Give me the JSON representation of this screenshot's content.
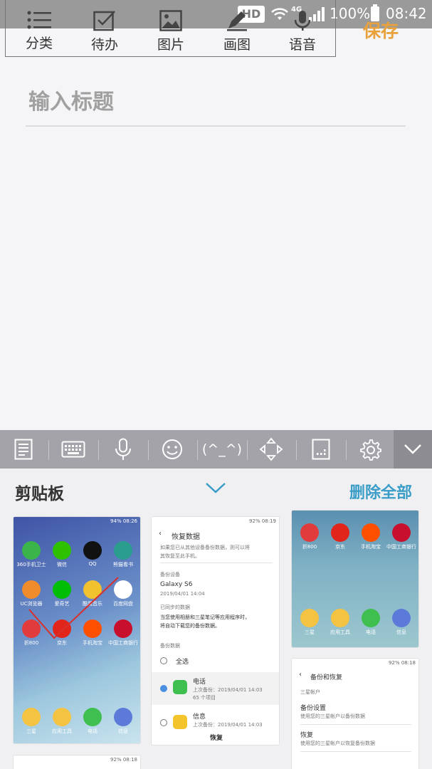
{
  "status_bar": {
    "hd": "HD",
    "network": "4G",
    "battery": "100%",
    "time": "08:42"
  },
  "toolbar": {
    "items": [
      {
        "label": "分类",
        "icon": "list-icon"
      },
      {
        "label": "待办",
        "icon": "checkbox-icon"
      },
      {
        "label": "图片",
        "icon": "image-icon"
      },
      {
        "label": "画图",
        "icon": "pen-icon"
      },
      {
        "label": "语音",
        "icon": "microphone-icon"
      }
    ],
    "save_label": "保存"
  },
  "editor": {
    "title_placeholder": "输入标题"
  },
  "keyboard_bar": {
    "buttons": [
      "notepad-icon",
      "keyboard-icon",
      "microphone-icon",
      "emoji-icon",
      "kaomoji",
      "cursor-move-icon",
      "handwriting-icon",
      "settings-icon",
      "collapse-icon"
    ],
    "kaomoji_label": "(^_^)"
  },
  "clipboard": {
    "title": "剪贴板",
    "delete_all_label": "删除全部",
    "thumb1": {
      "status": "94% 08:26",
      "apps": [
        {
          "name": "360手机卫士",
          "color": "#3bb54a"
        },
        {
          "name": "微信",
          "color": "#2dc100"
        },
        {
          "name": "QQ",
          "color": "#111111"
        },
        {
          "name": "熊猫看书",
          "color": "#2a9d8f"
        },
        {
          "name": "UC浏览器",
          "color": "#f08c2c"
        },
        {
          "name": "爱奇艺",
          "color": "#00be06"
        },
        {
          "name": "酷我音乐",
          "color": "#f2c12e"
        },
        {
          "name": "百度网盘",
          "color": "#ffffff"
        },
        {
          "name": "折800",
          "color": "#e23b3b"
        },
        {
          "name": "京东",
          "color": "#e1251b"
        },
        {
          "name": "手机淘宝",
          "color": "#ff5000"
        },
        {
          "name": "中国工商银行",
          "color": "#c8102e"
        }
      ],
      "dock": [
        {
          "name": "三星",
          "color": "#f5c342"
        },
        {
          "name": "应用工具",
          "color": "#f5c342"
        },
        {
          "name": "电话",
          "color": "#3fbf4f"
        },
        {
          "name": "信息",
          "color": "#5c7bd9"
        }
      ]
    },
    "thumb2": {
      "status": "92% 08:19",
      "header": "恢复数据",
      "desc1": "如果您已从其他设备备份数据，则可以将",
      "desc2": "其恢复至此手机。",
      "section_device": "备份设备",
      "device_name": "Galaxy S6",
      "device_date": "2019/04/01 14:04",
      "section_synced": "已同步的数据",
      "synced1": "当您使用相册和三星笔记等应用程序时，",
      "synced2": "将自动下载您的备份数据。",
      "section_backup": "备份数据",
      "select_all": "全选",
      "item1_name": "电话",
      "item1_sub1": "上次备份：2019/04/01 14:03",
      "item1_sub2": "65 个项目",
      "item2_name": "信息",
      "item2_sub1": "上次备份：2019/04/01 14:03",
      "restore_btn": "恢复"
    },
    "thumb3": {
      "apps": [
        {
          "name": "折800",
          "color": "#e23b3b"
        },
        {
          "name": "京东",
          "color": "#e1251b"
        },
        {
          "name": "手机淘宝",
          "color": "#ff5000"
        },
        {
          "name": "中国工商银行",
          "color": "#c8102e"
        }
      ],
      "dock": [
        {
          "name": "三星",
          "color": "#f5c342"
        },
        {
          "name": "应用工具",
          "color": "#f5c342"
        },
        {
          "name": "电话",
          "color": "#3fbf4f"
        },
        {
          "name": "信息",
          "color": "#5c7bd9"
        }
      ]
    },
    "thumb4": {
      "status": "92% 08:18",
      "header": "备份和恢复",
      "section": "三星帐户",
      "item1": "备份设置",
      "item1_sub": "使用您的三星帐户以备份数据",
      "item2": "恢复",
      "item2_sub": "使用您的三星帐户以恢复备份数据"
    },
    "thumb5": {
      "status": "92% 08:18"
    }
  }
}
